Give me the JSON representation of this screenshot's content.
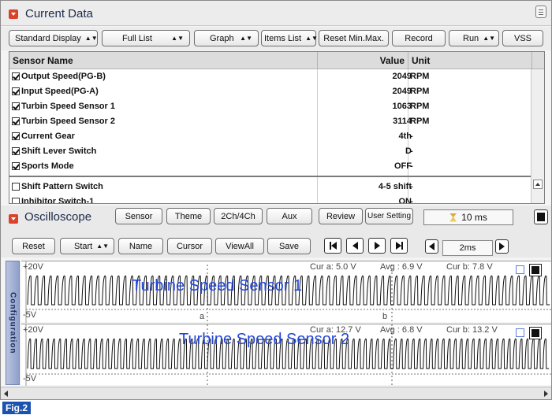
{
  "current_data": {
    "title": "Current Data",
    "toolbar": [
      {
        "label": "Standard Display",
        "dropdown": true
      },
      {
        "label": "Full List",
        "dropdown": true
      },
      {
        "label": "Graph",
        "dropdown": true
      },
      {
        "label": "Items List",
        "dropdown": true
      },
      {
        "label": "Reset Min.Max.",
        "dropdown": false
      },
      {
        "label": "Record",
        "dropdown": false
      },
      {
        "label": "Run",
        "dropdown": true
      },
      {
        "label": "VSS",
        "dropdown": false
      }
    ],
    "columns": {
      "name": "Sensor Name",
      "value": "Value",
      "unit": "Unit"
    },
    "rows": [
      {
        "name": "Output Speed(PG-B)",
        "value": "2049",
        "unit": "RPM",
        "checked": true
      },
      {
        "name": "Input Speed(PG-A)",
        "value": "2049",
        "unit": "RPM",
        "checked": true
      },
      {
        "name": "Turbin Speed Sensor 1",
        "value": "1063",
        "unit": "RPM",
        "checked": true
      },
      {
        "name": "Turbin Speed Sensor 2",
        "value": "3114",
        "unit": "RPM",
        "checked": true
      },
      {
        "name": "Current Gear",
        "value": "4th",
        "unit": "-",
        "checked": true
      },
      {
        "name": "Shift Lever Switch",
        "value": "D",
        "unit": "-",
        "checked": true
      },
      {
        "name": "Sports Mode",
        "value": "OFF",
        "unit": "-",
        "checked": true
      },
      {
        "name": "Shift Pattern Switch",
        "value": "4-5 shift",
        "unit": "-",
        "checked": false
      },
      {
        "name": "Inhibitor Switch-1",
        "value": "ON",
        "unit": "-",
        "checked": false
      }
    ]
  },
  "oscilloscope": {
    "title": "Oscilloscope",
    "top_buttons": [
      "Sensor",
      "Theme",
      "2Ch/4Ch",
      "Aux",
      "Review",
      "User Setting"
    ],
    "time_display": "10 ms",
    "second_buttons": [
      {
        "label": "Reset",
        "dropdown": false
      },
      {
        "label": "Start",
        "dropdown": true
      },
      {
        "label": "Name",
        "dropdown": false
      },
      {
        "label": "Cursor",
        "dropdown": false
      },
      {
        "label": "ViewAll",
        "dropdown": false
      },
      {
        "label": "Save",
        "dropdown": false
      }
    ],
    "timebase": "2ms",
    "side_tab": "Configuration",
    "channels": [
      {
        "name": "Turbine Speed Sensor 1",
        "ymax": "+20V",
        "ymin": "-5V",
        "cur_a": "Cur a: 5.0 V",
        "avg": "Avg : 6.9 V",
        "cur_b": "Cur b: 7.8 V",
        "cursor_a": "a",
        "cursor_b": "b"
      },
      {
        "name": "Turbine Speed Sensor 2",
        "ymax": "+20V",
        "ymin": "-5V",
        "cur_a": "Cur a: 12.7 V",
        "avg": "Avg : 6.8 V",
        "cur_b": "Cur b: 13.2 V"
      }
    ]
  },
  "figure_label": "Fig.2",
  "colors": {
    "accent_red": "#d9432b",
    "signal_text": "#2347d6",
    "fig_label_bg": "#1d53b0"
  }
}
